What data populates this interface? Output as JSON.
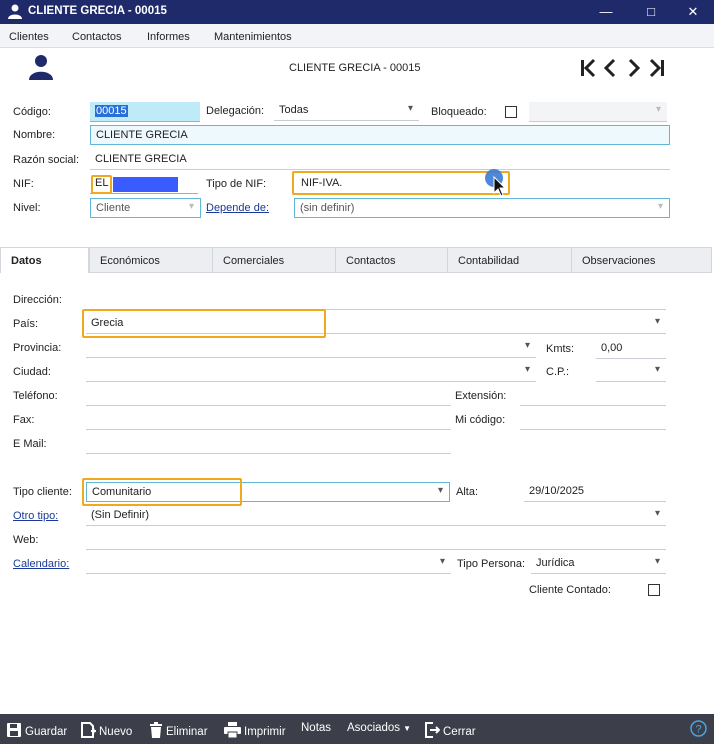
{
  "window": {
    "title": "CLIENTE GRECIA - 00015",
    "controls": {
      "minimize": "—",
      "maximize": "□",
      "close": "✕"
    }
  },
  "menu": [
    "Clientes",
    "Contactos",
    "Informes",
    "Mantenimientos"
  ],
  "header": {
    "title": "CLIENTE GRECIA - 00015"
  },
  "labels": {
    "codigo": "Código:",
    "delegacion": "Delegación:",
    "bloqueado": "Bloqueado:",
    "nombre": "Nombre:",
    "razon_social": "Razón social:",
    "nif": "NIF:",
    "tipo_nif": "Tipo de NIF:",
    "nivel": "Nivel:",
    "depende_de": "Depende de:",
    "direccion": "Dirección:",
    "pais": "País:",
    "provincia": "Provincia:",
    "kmts": "Kmts:",
    "ciudad": "Ciudad:",
    "cp": "C.P.:",
    "telefono": "Teléfono:",
    "extension": "Extensión:",
    "fax": "Fax:",
    "mi_codigo": "Mi código:",
    "email": "E Mail:",
    "tipo_cliente": "Tipo cliente:",
    "alta": "Alta:",
    "otro_tipo": "Otro tipo:",
    "web": "Web:",
    "calendario": "Calendario:",
    "tipo_persona": "Tipo Persona:",
    "cliente_contado": "Cliente Contado:"
  },
  "values": {
    "codigo": "00015",
    "delegacion": "Todas",
    "nombre": "CLIENTE GRECIA",
    "razon_social": "CLIENTE GRECIA",
    "nif_prefix": "EL",
    "tipo_nif": "NIF-IVA.",
    "nivel": "Cliente",
    "depende_de": "(sin definir)",
    "pais": "Grecia",
    "kmts": "0,00",
    "tipo_cliente": "Comunitario",
    "alta": "29/10/2025",
    "otro_tipo": "(Sin Definir)",
    "tipo_persona": "Jurídica"
  },
  "tabs": [
    "Datos",
    "Económicos",
    "Comerciales",
    "Contactos",
    "Contabilidad",
    "Observaciones"
  ],
  "toolbar": {
    "guardar": "Guardar",
    "nuevo": "Nuevo",
    "eliminar": "Eliminar",
    "imprimir": "Imprimir",
    "notas": "Notas",
    "asociados": "Asociados",
    "cerrar": "Cerrar"
  },
  "colors": {
    "titlebar": "#1f2a6b",
    "highlight": "#f0a81e",
    "redaction": "#3a5bff",
    "toolbar": "#3c3e4a"
  }
}
